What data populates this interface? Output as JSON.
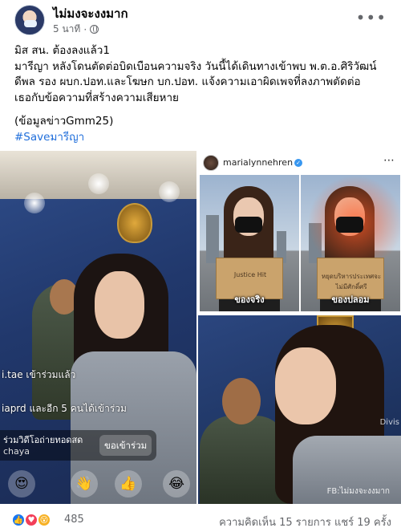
{
  "post": {
    "author": "ไม่มงจะงงมาก",
    "time": "5 นาที",
    "more_label": "•••",
    "lines": [
      "มิส สน. ต้องลงแล้ว1",
      "มารีญา หลังโดนตัดต่อบิดเบือนความจริง วันนี้ได้เดินทางเข้าพบ พ.ต.อ.ศิริวัฒน์",
      "ดีพล รอง ผบก.ปอท.และโฆษก บก.ปอท. แจ้งความเอาผิดเพจที่ลงภาพตัดต่อ",
      "เธอกับข้อความที่สร้างความเสียหาย"
    ],
    "source": "(ข้อมูลข่าวGmm25)",
    "hashtag": "#Saveมารีญา"
  },
  "live": {
    "comment1": "i.tae เข้าร่วมแล้ว",
    "comment2": "iaprd และอีก 5 คนได้เข้าร่วม",
    "join_line1": "ร่วมวิดีโอถ่ายทอดสด",
    "join_line2": "chaya",
    "join_button": "ขอเข้าร่วม",
    "reactions": [
      "😍",
      "👋",
      "👍",
      "😂"
    ]
  },
  "instagram": {
    "username": "marialynnehren",
    "verified_mark": "✓",
    "photos": [
      {
        "caption": "ของจริง",
        "sign_text": "Justice Hit"
      },
      {
        "caption": "ของปลอม",
        "sign_text": "หยุดบริหารประเทศจะไม่มีศักดิ์ศรี"
      }
    ]
  },
  "bottom_photo": {
    "division_text": "Divis",
    "watermark": "FB:ไม่มงจะงงมาก"
  },
  "footer": {
    "reaction_count": "485",
    "comments_shares": "ความคิดเห็น 15 รายการ  แชร์ 19 ครั้ง"
  },
  "colors": {
    "link": "#216fdb",
    "like": "#1877f2",
    "love": "#f33e58",
    "wow": "#f7b125"
  }
}
